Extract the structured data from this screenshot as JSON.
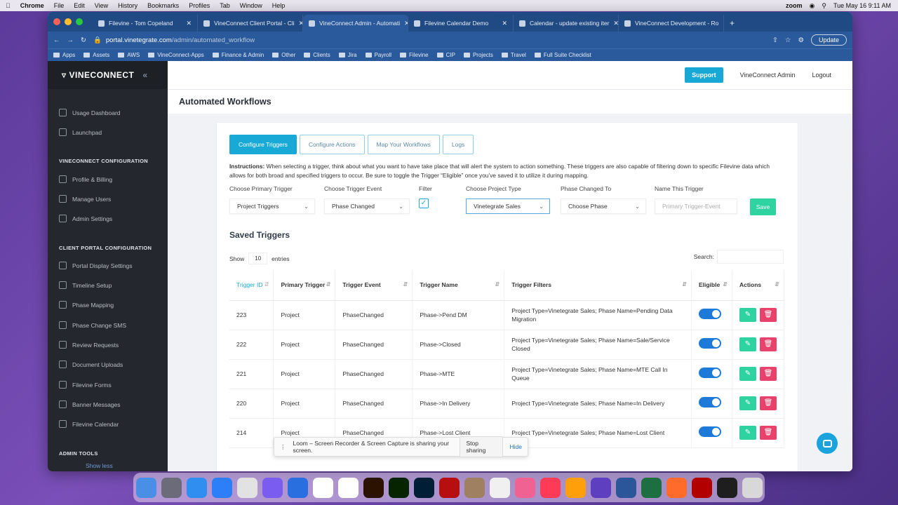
{
  "menubar": {
    "app": "Chrome",
    "items": [
      "File",
      "Edit",
      "View",
      "History",
      "Bookmarks",
      "Profiles",
      "Tab",
      "Window",
      "Help"
    ],
    "zoom": "zoom",
    "clock": "Tue May 16  9:11 AM"
  },
  "tabs": [
    {
      "label": "Filevine - Tom Copeland"
    },
    {
      "label": "VineConnect Client Portal - Cli"
    },
    {
      "label": "VineConnect Admin - Automati"
    },
    {
      "label": "Filevine Calendar Demo"
    },
    {
      "label": "Calendar - update existing iter"
    },
    {
      "label": "VineConnect Development - Ro"
    }
  ],
  "address": {
    "host": "portal.vinetegrate.com",
    "path": "/admin/automated_workflow",
    "update": "Update"
  },
  "bookmarks": [
    "Apps",
    "Assets",
    "AWS",
    "VineConnect-Apps",
    "Finance & Admin",
    "Other",
    "Clients",
    "Jira",
    "Payroll",
    "Filevine",
    "CIP",
    "Projects",
    "Travel",
    "Full Suite Checklist"
  ],
  "sidebar": {
    "logo": "VINECONNECT",
    "items_top": [
      {
        "label": "Usage Dashboard"
      },
      {
        "label": "Launchpad"
      }
    ],
    "sec1": "VINECONNECT CONFIGURATION",
    "items_cfg": [
      {
        "label": "Profile & Billing"
      },
      {
        "label": "Manage Users"
      },
      {
        "label": "Admin Settings"
      }
    ],
    "sec2": "CLIENT PORTAL CONFIGURATION",
    "items_portal": [
      {
        "label": "Portal Display Settings"
      },
      {
        "label": "Timeline Setup"
      },
      {
        "label": "Phase Mapping"
      },
      {
        "label": "Phase Change SMS"
      },
      {
        "label": "Review Requests"
      },
      {
        "label": "Document Uploads"
      },
      {
        "label": "Filevine Forms"
      },
      {
        "label": "Banner Messages"
      },
      {
        "label": "Filevine Calendar"
      }
    ],
    "sec3": "ADMIN TOOLS",
    "show_less": "Show less"
  },
  "topnav": {
    "support": "Support",
    "admin": "VineConnect Admin",
    "logout": "Logout"
  },
  "page": {
    "title": "Automated Workflows"
  },
  "workflow_tabs": [
    "Configure Triggers",
    "Configure Actions",
    "Map Your Workflows",
    "Logs"
  ],
  "instructions": {
    "bold": "Instructions:",
    "text": " When selecting a trigger, think about what you want to have take place that will alert the system to action something. These triggers are also capable of filtering down to specific Filevine data which allows for both broad and specified triggers to occur. Be sure to toggle the Trigger “Eligible” once you’ve saved it to utilize it during mapping."
  },
  "form": {
    "primary_label": "Choose Primary Trigger",
    "primary_value": "Project Triggers",
    "event_label": "Choose Trigger Event",
    "event_value": "Phase Changed",
    "filter_label": "Filter",
    "type_label": "Choose Project Type",
    "type_value": "Vinetegrate Sales",
    "phase_label": "Phase Changed To",
    "phase_value": "Choose Phase",
    "name_label": "Name This Trigger",
    "name_placeholder": "Primary Trigger-Event",
    "save": "Save"
  },
  "saved": {
    "title": "Saved Triggers",
    "show": "Show",
    "entries_count": "10",
    "entries": "entries",
    "search": "Search:"
  },
  "table": {
    "headers": [
      "Trigger ID",
      "Primary Trigger",
      "Trigger Event",
      "Trigger Name",
      "Trigger Filters",
      "Eligible",
      "Actions"
    ],
    "rows": [
      {
        "id": "223",
        "primary": "Project",
        "event": "PhaseChanged",
        "name": "Phase->Pend DM",
        "filters": "Project Type=Vinetegrate Sales; Phase Name=Pending Data Migration"
      },
      {
        "id": "222",
        "primary": "Project",
        "event": "PhaseChanged",
        "name": "Phase->Closed",
        "filters": "Project Type=Vinetegrate Sales; Phase Name=Sale/Service Closed"
      },
      {
        "id": "221",
        "primary": "Project",
        "event": "PhaseChanged",
        "name": "Phase->MTE",
        "filters": "Project Type=Vinetegrate Sales; Phase Name=MTE Call In Queue"
      },
      {
        "id": "220",
        "primary": "Project",
        "event": "PhaseChanged",
        "name": "Phase->In Delivery",
        "filters": "Project Type=Vinetegrate Sales; Phase Name=In Delivery"
      },
      {
        "id": "214",
        "primary": "Project",
        "event": "PhaseChanged",
        "name": "Phase->Lost Client",
        "filters": "Project Type=Vinetegrate Sales; Phase Name=Lost Client"
      }
    ]
  },
  "loom": {
    "text": "Loom – Screen Recorder & Screen Capture is sharing your screen.",
    "stop": "Stop sharing",
    "hide": "Hide"
  },
  "dock_colors": [
    "#4a8fe6",
    "#6b6b7a",
    "#2f8ef0",
    "#2d7ff9",
    "#e2e2e2",
    "#7a5cf0",
    "#2a6fe0",
    "#ffffff",
    "#ffffff",
    "#2c1200",
    "#072401",
    "#001e36",
    "#b70f0f",
    "#9f8060",
    "#f0f0f0",
    "#f06292",
    "#ff3b57",
    "#ff9f0a",
    "#5e3fbf",
    "#2b579a",
    "#1d6f42",
    "#ff6b2a",
    "#b20000",
    "#1e1e1e",
    "#d8d8d8"
  ]
}
